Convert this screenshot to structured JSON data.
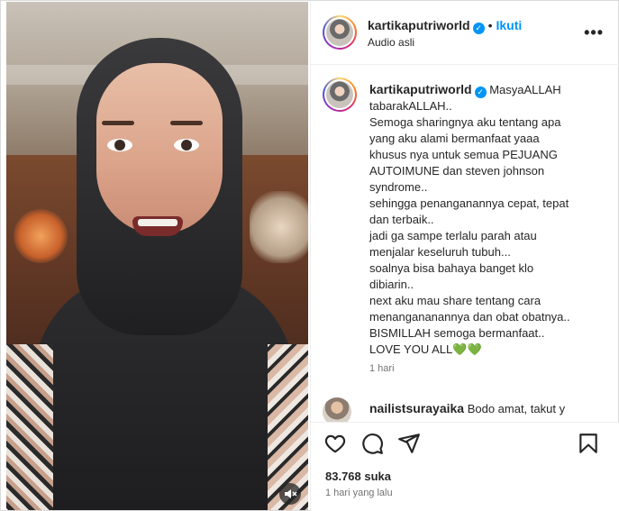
{
  "post": {
    "username": "kartikaputriworld",
    "follow_label": "Ikuti",
    "dot": "•",
    "audio_label": "Audio asli",
    "caption_lines": [
      "MasyaALLAH",
      "tabarakALLAH..",
      "Semoga sharingnya aku tentang apa",
      "yang aku alami bermanfaat yaaa",
      "khusus nya untuk semua PEJUANG",
      "AUTOIMUNE dan steven johnson",
      "syndrome..",
      "sehingga penanganannya cepat, tepat",
      "dan terbaik..",
      "jadi ga sampe terlalu parah atau",
      "menjalar keseluruh tubuh...",
      "soalnya bisa bahaya banget klo",
      "dibiarin..",
      "next aku mau share tentang cara",
      "menangananannya dan obat obatnya..",
      "BISMILLAH semoga bermanfaat..",
      "LOVE YOU ALL💚💚"
    ],
    "caption_age": "1 hari",
    "comment": {
      "username": "nailistsurayaika",
      "text": "Bodo amat, takut y"
    },
    "likes_label": "83.768 suka",
    "date_label": "1 hari yang lalu"
  },
  "icons": {
    "more": "more-options-icon",
    "like": "heart-icon",
    "comment": "comment-icon",
    "share": "share-icon",
    "save": "bookmark-icon",
    "verified": "verified-badge-icon",
    "mute": "mute-icon"
  },
  "colors": {
    "accent": "#0095f6",
    "text": "#262626",
    "muted": "#737373",
    "border": "#efefef"
  }
}
